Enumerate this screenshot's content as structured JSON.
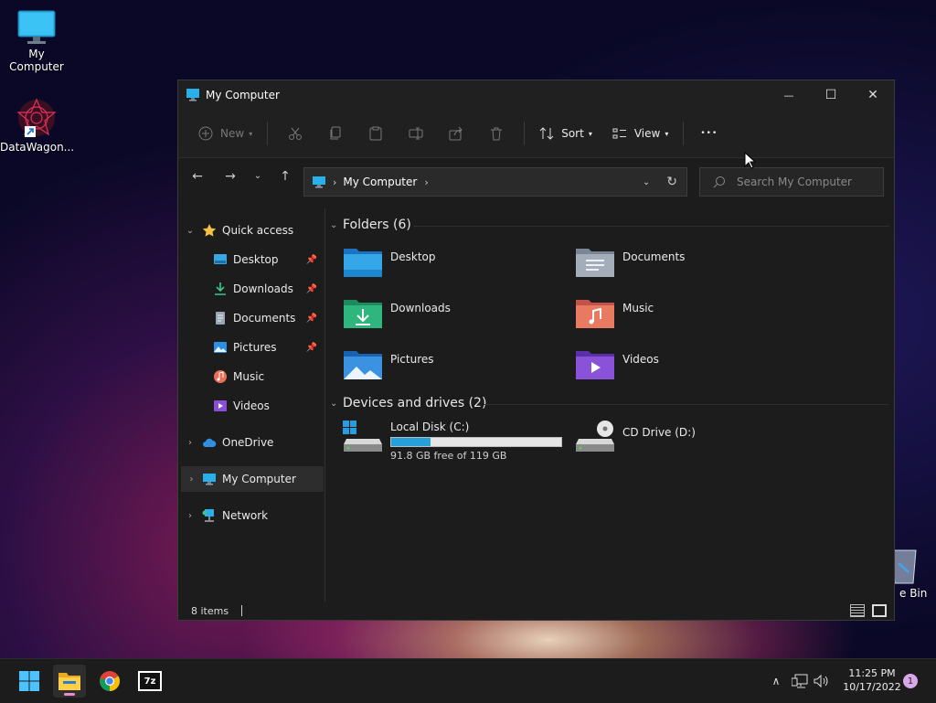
{
  "desktop": {
    "icons": [
      {
        "label": "My Computer"
      },
      {
        "label": "DataWagon..."
      },
      {
        "label": "e Bin"
      }
    ]
  },
  "window": {
    "title": "My Computer",
    "controls": {
      "minimize": "—",
      "maximize": "☐",
      "close": "✕"
    }
  },
  "toolbar": {
    "new_label": "New",
    "sort_label": "Sort",
    "view_label": "View",
    "more_label": "•••"
  },
  "address": {
    "location": "My Computer",
    "search_placeholder": "Search My Computer"
  },
  "sidebar": {
    "items": [
      {
        "label": "Quick access"
      },
      {
        "label": "Desktop"
      },
      {
        "label": "Downloads"
      },
      {
        "label": "Documents"
      },
      {
        "label": "Pictures"
      },
      {
        "label": "Music"
      },
      {
        "label": "Videos"
      },
      {
        "label": "OneDrive"
      },
      {
        "label": "My Computer"
      },
      {
        "label": "Network"
      }
    ]
  },
  "content": {
    "folders_header": "Folders (6)",
    "folders": [
      {
        "name": "Desktop"
      },
      {
        "name": "Documents"
      },
      {
        "name": "Downloads"
      },
      {
        "name": "Music"
      },
      {
        "name": "Pictures"
      },
      {
        "name": "Videos"
      }
    ],
    "drives_header": "Devices and drives (2)",
    "drives": [
      {
        "name": "Local Disk (C:)",
        "free_text": "91.8 GB free of 119 GB",
        "used_fraction": 0.23
      },
      {
        "name": "CD Drive (D:)"
      }
    ]
  },
  "statusbar": {
    "count": "8 items"
  },
  "taskbar": {
    "time": "11:25 PM",
    "date": "10/17/2022",
    "notification_count": "1",
    "sevenzip_label": "7z"
  },
  "colors": {
    "accent": "#26a0da",
    "window_bg": "#1c1c1c"
  }
}
